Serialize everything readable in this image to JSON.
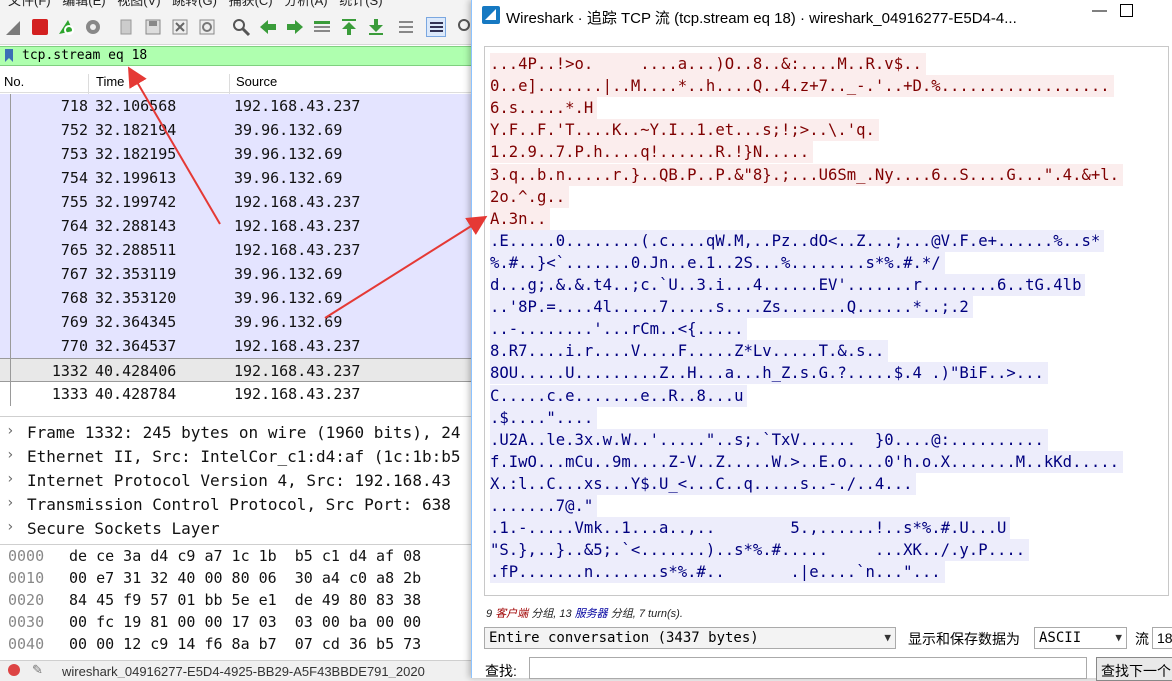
{
  "main_window": {
    "menu": [
      "文件(F)",
      "编辑(E)",
      "视图(V)",
      "跳转(G)",
      "捕获(C)",
      "分析(A)",
      "统计(S)"
    ],
    "filter": {
      "value": "tcp.stream eq 18"
    },
    "columns": {
      "no": "No.",
      "time": "Time",
      "source": "Source"
    },
    "packets": [
      {
        "no": "718",
        "time": "32.106568",
        "source": "192.168.43.237"
      },
      {
        "no": "752",
        "time": "32.182194",
        "source": "39.96.132.69"
      },
      {
        "no": "753",
        "time": "32.182195",
        "source": "39.96.132.69"
      },
      {
        "no": "754",
        "time": "32.199613",
        "source": "39.96.132.69"
      },
      {
        "no": "755",
        "time": "32.199742",
        "source": "192.168.43.237"
      },
      {
        "no": "764",
        "time": "32.288143",
        "source": "192.168.43.237"
      },
      {
        "no": "765",
        "time": "32.288511",
        "source": "192.168.43.237"
      },
      {
        "no": "767",
        "time": "32.353119",
        "source": "39.96.132.69"
      },
      {
        "no": "768",
        "time": "32.353120",
        "source": "39.96.132.69"
      },
      {
        "no": "769",
        "time": "32.364345",
        "source": "39.96.132.69"
      },
      {
        "no": "770",
        "time": "32.364537",
        "source": "192.168.43.237"
      },
      {
        "no": "1332",
        "time": "40.428406",
        "source": "192.168.43.237"
      },
      {
        "no": "1333",
        "time": "40.428784",
        "source": "192.168.43.237"
      }
    ],
    "details": [
      "Frame 1332: 245 bytes on wire (1960 bits), 24",
      "Ethernet II, Src: IntelCor_c1:d4:af (1c:1b:b5",
      "Internet Protocol Version 4, Src: 192.168.43",
      "Transmission Control Protocol, Src Port: 638",
      "Secure Sockets Layer"
    ],
    "hex": [
      {
        "offset": "0000",
        "bytes": "de ce 3a d4 c9 a7 1c 1b  b5 c1 d4 af 08"
      },
      {
        "offset": "0010",
        "bytes": "00 e7 31 32 40 00 80 06  30 a4 c0 a8 2b"
      },
      {
        "offset": "0020",
        "bytes": "84 45 f9 57 01 bb 5e e1  de 49 80 83 38"
      },
      {
        "offset": "0030",
        "bytes": "00 fc 19 81 00 00 17 03  03 00 ba 00 00"
      },
      {
        "offset": "0040",
        "bytes": "00 00 12 c9 14 f6 8a b7  07 cd 36 b5 73"
      }
    ],
    "status_file": "wireshark_04916277-E5D4-4925-BB29-A5F43BBDE791_2020"
  },
  "dialog": {
    "title": "Wireshark · 追踪 TCP 流 (tcp.stream eq 18) · wireshark_04916277-E5D4-4...",
    "stream_lines": [
      {
        "dir": "client",
        "text": "...4P..!>o.     ....a...)O..8..&:....M..R.v$.."
      },
      {
        "dir": "client",
        "text": "0..e].......|..M....*..h....Q..4.z+7.._-.'..+D.%.................."
      },
      {
        "dir": "client",
        "text": "6.s.....*.H"
      },
      {
        "dir": "client",
        "text": "Y.F..F.'T....K..~Y.I..1.et...s;!;>..\\.'q."
      },
      {
        "dir": "client",
        "text": "1.2.9..7.P.h....q!......R.!}N....."
      },
      {
        "dir": "client",
        "text": "3.q..b.n.....r.}..QB.P..P.&\"8}.;...U6Sm_.Ny....6..S....G...\".4.&+l."
      },
      {
        "dir": "client",
        "text": "2o.^.g.."
      },
      {
        "dir": "client",
        "text": "A.3n.."
      },
      {
        "dir": "server",
        "text": ".E.....0........(.c....qW.M,..Pz..dO<..Z...;...@V.F.e+......%..s*"
      },
      {
        "dir": "server",
        "text": "%.#..}<`.......0.Jn..e.1..2S...%........s*%.#.*/"
      },
      {
        "dir": "server",
        "text": "d...g;.&.&.t4..;c.`U..3.i...4......EV'.......r........6..tG.4lb"
      },
      {
        "dir": "server",
        "text": "..'8P.=....4l.....7.....s....Zs.......Q......*..;.2"
      },
      {
        "dir": "server",
        "text": "..-........'...rCm..<{....."
      },
      {
        "dir": "server",
        "text": "8.R7....i.r....V....F.....Z*Lv.....T.&.s.."
      },
      {
        "dir": "server",
        "text": "8OU.....U.........Z..H...a...h_Z.s.G.?.....$.4 .)\"BiF..>..."
      },
      {
        "dir": "server",
        "text": "C.....c.e.......e..R..8...u"
      },
      {
        "dir": "server",
        "text": ".$....\"...."
      },
      {
        "dir": "server",
        "text": ".U2A..le.3x.w.W..'.....\"..s;.`TxV......  }0....@:.........."
      },
      {
        "dir": "server",
        "text": "f.IwO...mCu..9m....Z-V..Z.....W.>..E.o....0'h.o.X.......M..kKd....."
      },
      {
        "dir": "server",
        "text": "X.:l..C...xs...Y$.U_<...C..q.....s..-./..4..."
      },
      {
        "dir": "server",
        "text": ".......7@.\""
      },
      {
        "dir": "server",
        "text": ".1.-.....Vmk..1...a..,..        5.,......!..s*%.#.U...U"
      },
      {
        "dir": "server",
        "text": "\"S.},..}..&5;.`<.......)..s*%.#.....     ...XK../.y.P...."
      },
      {
        "dir": "server",
        "text": ".fP.......n.......s*%.#..       .|e....`n...\"..."
      }
    ],
    "stats": {
      "client_count": "9",
      "client_label": "客户端",
      "pkt1": "分组,",
      "server_count": "13",
      "server_label": "服务器",
      "pkt2": "分组,",
      "turns": "7 turn(s)."
    },
    "conversation_select": "Entire conversation (3437 bytes)",
    "show_as_label": "显示和保存数据为",
    "encoding_select": "ASCII",
    "stream_label": "流",
    "stream_number": "18",
    "find_label": "查找:",
    "find_value": "",
    "find_next_button": "查找下一个"
  },
  "colors": {
    "filter_bg": "#afffaf",
    "tls_row": "#e4e4ff",
    "client_bg": "#fbeded",
    "client_fg": "#7f0000",
    "server_bg": "#ededfb",
    "server_fg": "#00007f",
    "arrow": "#e53935"
  }
}
